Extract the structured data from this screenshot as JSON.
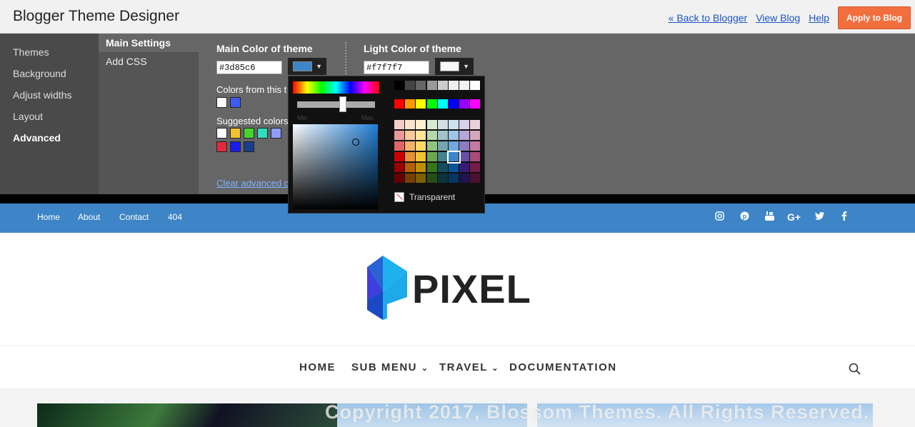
{
  "app": {
    "title": "Blogger Theme Designer",
    "links": {
      "back": "« Back to Blogger",
      "view_blog": "View Blog",
      "help": "Help"
    },
    "apply_button": "Apply to Blog"
  },
  "designer": {
    "left_nav": [
      "Themes",
      "Background",
      "Adjust widths",
      "Layout",
      "Advanced"
    ],
    "left_nav_active": "Advanced",
    "sub_nav": [
      "Main Settings",
      "Add CSS"
    ],
    "sub_nav_active": "Main Settings",
    "main_color": {
      "label": "Main Color of theme",
      "value": "#3d85c6",
      "swatch": "#3d85c6"
    },
    "light_color": {
      "label": "Light Color of theme",
      "value": "#f7f7f7",
      "swatch": "#f7f7f7"
    },
    "colors_from_theme_label": "Colors from this t",
    "colors_from_theme": [
      "#ffffff",
      "#3d5af1"
    ],
    "suggested_label": "Suggested colors",
    "suggested_colors": [
      "#ffffff",
      "#f1c232",
      "#45d62e",
      "#2edcbf",
      "#8e9dff",
      "#e02b3c",
      "#1c1cf0",
      "#1b3e8c"
    ],
    "clear_link": "Clear advanced c"
  },
  "color_picker": {
    "min_label": "Min",
    "max_label": "Max",
    "transparent_label": "Transparent",
    "grays": [
      "#000000",
      "#444444",
      "#666666",
      "#999999",
      "#cccccc",
      "#eeeeee",
      "#f3f3f3",
      "#ffffff"
    ],
    "brights": [
      "#ff0000",
      "#ff9900",
      "#ffff00",
      "#00ff00",
      "#00ffff",
      "#0000ff",
      "#9900ff",
      "#ff00ff"
    ],
    "palette": [
      [
        "#f4cccc",
        "#fce5cd",
        "#fff2cc",
        "#d9ead3",
        "#d0e0e3",
        "#cfe2f3",
        "#d9d2e9",
        "#ead1dc"
      ],
      [
        "#ea9999",
        "#f9cb9c",
        "#ffe599",
        "#b6d7a8",
        "#a2c4c9",
        "#9fc5e8",
        "#b4a7d6",
        "#d5a6bd"
      ],
      [
        "#e06666",
        "#f6b26b",
        "#ffd966",
        "#93c47d",
        "#76a5af",
        "#6fa8dc",
        "#8e7cc3",
        "#c27ba0"
      ],
      [
        "#cc0000",
        "#e69138",
        "#f1c232",
        "#6aa84f",
        "#45818e",
        "#3d85c6",
        "#674ea7",
        "#a64d79"
      ],
      [
        "#990000",
        "#b45f06",
        "#bf9000",
        "#38761d",
        "#134f5c",
        "#0b5394",
        "#351c75",
        "#741b47"
      ],
      [
        "#660000",
        "#783f04",
        "#7f6000",
        "#274e13",
        "#0c343d",
        "#073763",
        "#20124d",
        "#4c1130"
      ]
    ],
    "selected": "#3d85c6"
  },
  "blog": {
    "nav_color": "#3d85c6",
    "top_menu": [
      "Home",
      "About",
      "Contact",
      "404"
    ],
    "social_icons": [
      "instagram-icon",
      "pinterest-icon",
      "youtube-icon",
      "google-plus-icon",
      "twitter-icon",
      "facebook-icon"
    ],
    "logo_text": "PIXEL",
    "main_menu": [
      "HOME",
      "SUB MENU",
      "TRAVEL",
      "DOCUMENTATION"
    ],
    "watermark": "Copyright 2017, Blossom Themes. All Rights Reserved."
  }
}
